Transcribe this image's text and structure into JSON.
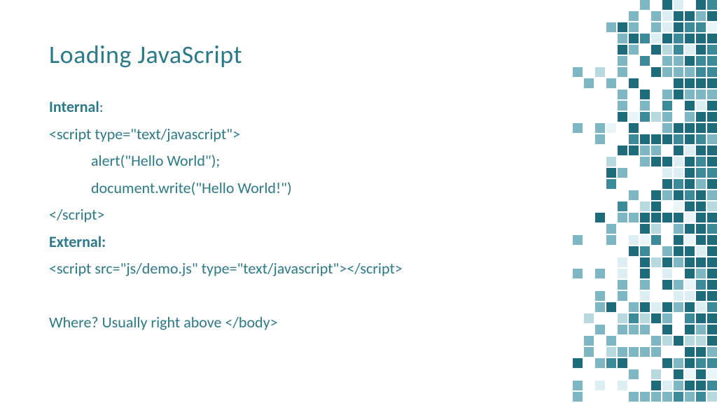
{
  "title": "Loading JavaScript",
  "lines": {
    "internal_label": "Internal",
    "internal_colon": ":",
    "script_open": "<script type=\"text/javascript\">",
    "alert_line": "alert(\"Hello World\");",
    "docwrite_line": "document.write(\"Hello World!\")",
    "script_close": "</script>",
    "external_label": "External:",
    "external_script": "<script src=\"js/demo.js\" type=\"text/javascript\"></script>",
    "where_line": "Where? Usually right above </body>"
  },
  "deco_colors": {
    "dark": "#1e6b7a",
    "mid": "#3d8a99",
    "light": "#7db8c2",
    "pale": "#b8d9de",
    "paler": "#dceef1",
    "palest": "#e8f4f6"
  }
}
